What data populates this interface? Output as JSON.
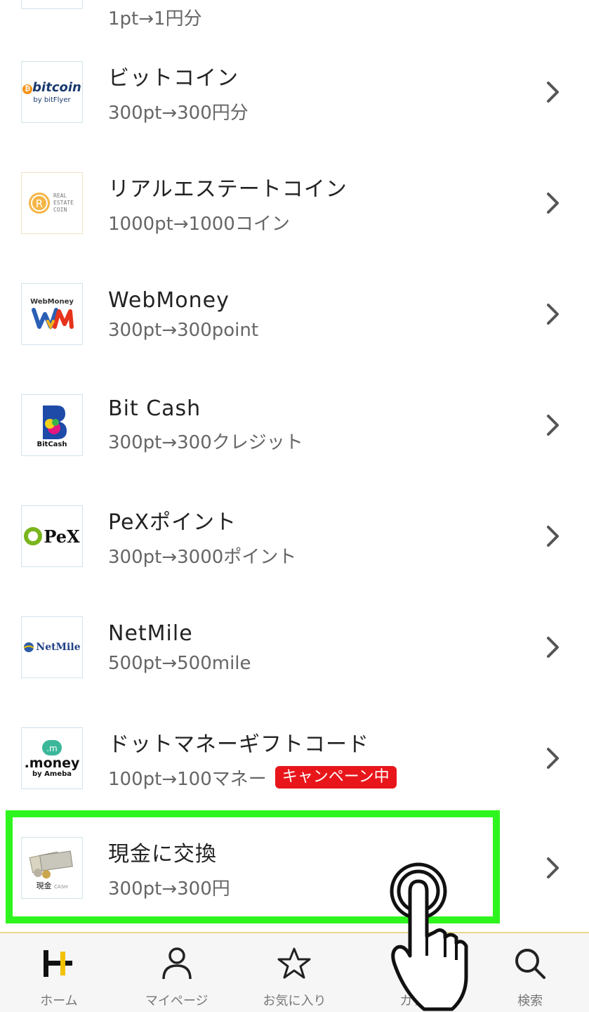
{
  "top_partial_rate": "1pt→1円分",
  "items": [
    {
      "name": "ビットコイン",
      "rate": "300pt→300円分",
      "logo": "bitcoin-bitflyer-logo",
      "logo_text": "bitcoin",
      "logo_sub": "bitFlyer"
    },
    {
      "name": "リアルエステートコイン",
      "rate": "1000pt→1000コイン",
      "logo": "real-estate-coin-logo",
      "logo_text": "REAL ESTATE COIN"
    },
    {
      "name": "WebMoney",
      "rate": "300pt→300point",
      "logo": "webmoney-logo",
      "logo_text": "WebMoney"
    },
    {
      "name": "Bit Cash",
      "rate": "300pt→300クレジット",
      "logo": "bitcash-logo",
      "logo_text": "BitCash"
    },
    {
      "name": "PeXポイント",
      "rate": "300pt→3000ポイント",
      "logo": "pex-logo",
      "logo_text": "PeX"
    },
    {
      "name": "NetMile",
      "rate": "500pt→500mile",
      "logo": "netmile-logo",
      "logo_text": "NetMile"
    },
    {
      "name": "ドットマネーギフトコード",
      "rate": "100pt→100マネー",
      "badge": "キャンペーン中",
      "logo": "dot-money-logo",
      "logo_text": ".money",
      "logo_sub": "Ameba"
    },
    {
      "name": "現金に交換",
      "rate": "300pt→300円",
      "logo": "cash-logo",
      "logo_text": "現金",
      "logo_sub": "CASH"
    }
  ],
  "tabs": [
    {
      "label": "ホーム",
      "icon": "home-logo-icon"
    },
    {
      "label": "マイページ",
      "icon": "person-icon"
    },
    {
      "label": "お気に入り",
      "icon": "star-icon"
    },
    {
      "label": "カテ",
      "icon": "category-icon"
    },
    {
      "label": "検索",
      "icon": "search-icon"
    }
  ],
  "colors": {
    "highlight": "#2ef51d",
    "badge": "#e8161b",
    "accent_yellow": "#f2c200"
  }
}
